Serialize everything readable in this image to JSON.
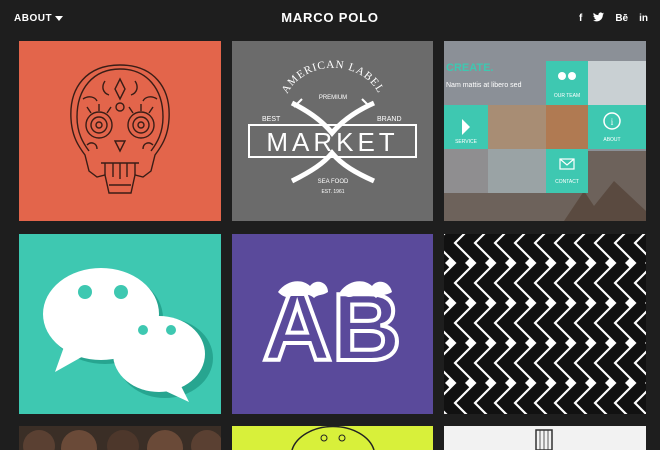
{
  "header": {
    "menu_label": "ABOUT",
    "title": "MARCO POLO",
    "social": {
      "facebook": "f",
      "twitter": "t",
      "behance": "Bē",
      "linkedin": "in"
    }
  },
  "tiles": {
    "market": {
      "arc_text": "AMERICAN LABEL",
      "premium": "PREMIUM",
      "best": "BEST",
      "brand": "BRAND",
      "word": "MARKET",
      "sea_food": "SEA FOOD",
      "est": "EST. 1961"
    },
    "website": {
      "headline": "CREATE.",
      "tagline": "Nam mattis at libero sed",
      "menu": {
        "team": "OUR TEAM",
        "service": "SERVICE",
        "about": "ABOUT",
        "contact": "CONTACT"
      }
    },
    "letters": "AB"
  },
  "colors": {
    "background": "#1e1e1e",
    "coral": "#e3654b",
    "grey": "#6b6b6b",
    "teal": "#3ec8b1",
    "purple": "#5a4a9b",
    "lime": "#d8f03a"
  }
}
